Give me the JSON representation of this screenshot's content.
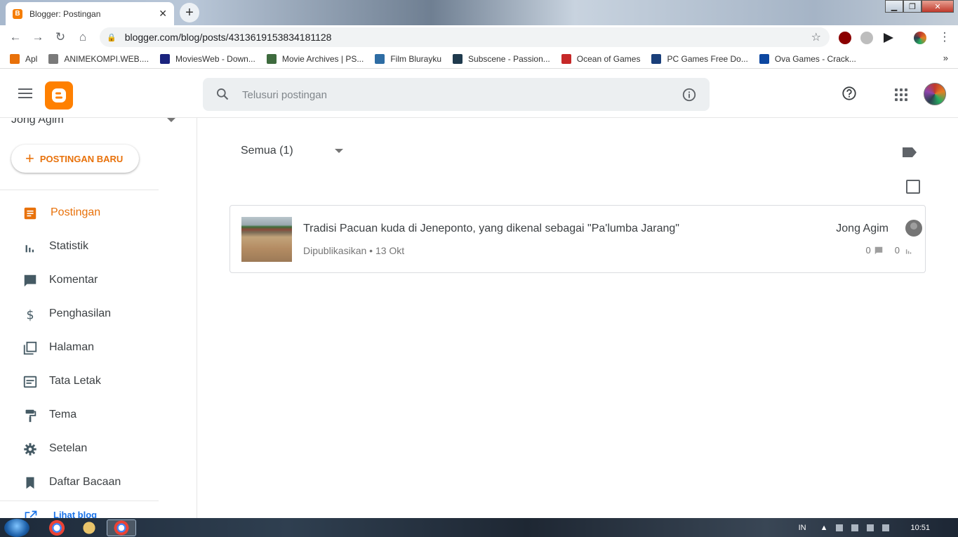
{
  "browser": {
    "tab_title": "Blogger: Postingan",
    "url": "blogger.com/blog/posts/4313619153834181128",
    "bookmarks": [
      {
        "label": "Apl",
        "icon": "apps-grid-icon",
        "color": "#e8710a"
      },
      {
        "label": "ANIMEKOMPI.WEB....",
        "icon": "anime-icon",
        "color": "#7a7a7a"
      },
      {
        "label": "MoviesWeb - Down...",
        "icon": "moviesweb-icon",
        "color": "#1a237e"
      },
      {
        "label": "Movie Archives | PS...",
        "icon": "movie-archive-icon",
        "color": "#3e6b3e"
      },
      {
        "label": "Film Blurayku",
        "icon": "film-icon",
        "color": "#2e6da4"
      },
      {
        "label": "Subscene - Passion...",
        "icon": "subscene-icon",
        "color": "#1f3a4d"
      },
      {
        "label": "Ocean of Games",
        "icon": "gamepad-icon",
        "color": "#c62828"
      },
      {
        "label": "PC Games Free Do...",
        "icon": "pcgames-icon",
        "color": "#1a3f7a"
      },
      {
        "label": "Ova Games - Crack...",
        "icon": "ova-icon",
        "color": "#0d47a1"
      }
    ],
    "bookmarks_more": "»"
  },
  "header": {
    "search_placeholder": "Telusuri postingan"
  },
  "sidebar": {
    "blog_name": "Jong Agim",
    "new_post_label": "POSTINGAN BARU",
    "items": [
      {
        "label": "Postingan",
        "icon": "posts-icon",
        "active": true
      },
      {
        "label": "Statistik",
        "icon": "stats-icon"
      },
      {
        "label": "Komentar",
        "icon": "comment-icon"
      },
      {
        "label": "Penghasilan",
        "icon": "dollar-icon"
      },
      {
        "label": "Halaman",
        "icon": "pages-icon"
      },
      {
        "label": "Tata Letak",
        "icon": "layout-icon"
      },
      {
        "label": "Tema",
        "icon": "paint-roller-icon"
      },
      {
        "label": "Setelan",
        "icon": "gear-icon"
      },
      {
        "label": "Daftar Bacaan",
        "icon": "bookmark-icon"
      }
    ],
    "view_blog_label": "Lihat blog"
  },
  "main": {
    "filter_label": "Semua (1)",
    "posts": [
      {
        "title": "Tradisi Pacuan kuda di Jeneponto, yang dikenal sebagai \"Pa'lumba Jarang\"",
        "meta": "Dipublikasikan • 13 Okt",
        "author": "Jong Agim",
        "comments": "0",
        "views": "0"
      }
    ]
  },
  "taskbar": {
    "lang": "IN",
    "clock": "10:51"
  },
  "colors": {
    "accent": "#e8710a",
    "blogger_orange": "#ff8000"
  }
}
